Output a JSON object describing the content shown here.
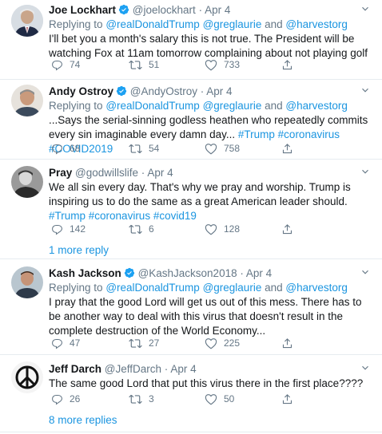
{
  "colors": {
    "link": "#1b95e0",
    "muted": "#657786",
    "text": "#14171a",
    "divider": "#e6ecf0",
    "verified": "#1da1f2"
  },
  "replying_prefix": "Replying to",
  "replying_conj": "and",
  "tweets": [
    {
      "name": "Joe Lockhart",
      "verified": true,
      "handle": "@joelockhart",
      "date": "Apr 4",
      "replying": [
        "@realDonaldTrump",
        "@greglaurie",
        "@harvestorg"
      ],
      "text": "I'll bet you a month's salary this is not true.  The President will be watching Fox at 11am tomorrow complaining about not playing golf",
      "hashtags": [],
      "replies": "74",
      "retweets": "51",
      "likes": "733"
    },
    {
      "name": "Andy Ostroy",
      "verified": true,
      "handle": "@AndyOstroy",
      "date": "Apr 4",
      "replying": [
        "@realDonaldTrump",
        "@greglaurie",
        "@harvestorg"
      ],
      "text": "...Says the serial-sinning godless heathen who repeatedly commits every sin imaginable every damn day...",
      "hashtags": [
        "#Trump",
        "#coronavirus",
        "#COVID2019"
      ],
      "replies": "68",
      "retweets": "54",
      "likes": "758"
    },
    {
      "name": "Pray",
      "verified": false,
      "handle": "@godwillslife",
      "date": "Apr 4",
      "replying": [],
      "text": "We all sin every day.  That's why we pray and worship.  Trump is inspiring us to do the same as a great American leader should.",
      "hashtags": [
        "#Trump",
        "#coronavirus",
        "#covid19"
      ],
      "replies": "142",
      "retweets": "6",
      "likes": "128"
    },
    {
      "name": "Kash Jackson",
      "verified": true,
      "handle": "@KashJackson2018",
      "date": "Apr 4",
      "replying": [
        "@realDonaldTrump",
        "@greglaurie",
        "@harvestorg"
      ],
      "text": "I pray that the good Lord will get us out of this mess. There has to be another way to deal with this virus that doesn't result in the complete destruction of the World Economy...",
      "hashtags": [],
      "replies": "47",
      "retweets": "27",
      "likes": "225"
    },
    {
      "name": "Jeff Darch",
      "verified": false,
      "handle": "@JeffDarch",
      "date": "Apr 4",
      "replying": [],
      "text": "The same good Lord that put this virus there in the first place????",
      "hashtags": [],
      "replies": "26",
      "retweets": "3",
      "likes": "50"
    }
  ],
  "more_replies_1": "1 more reply",
  "more_replies_2": "8 more replies"
}
